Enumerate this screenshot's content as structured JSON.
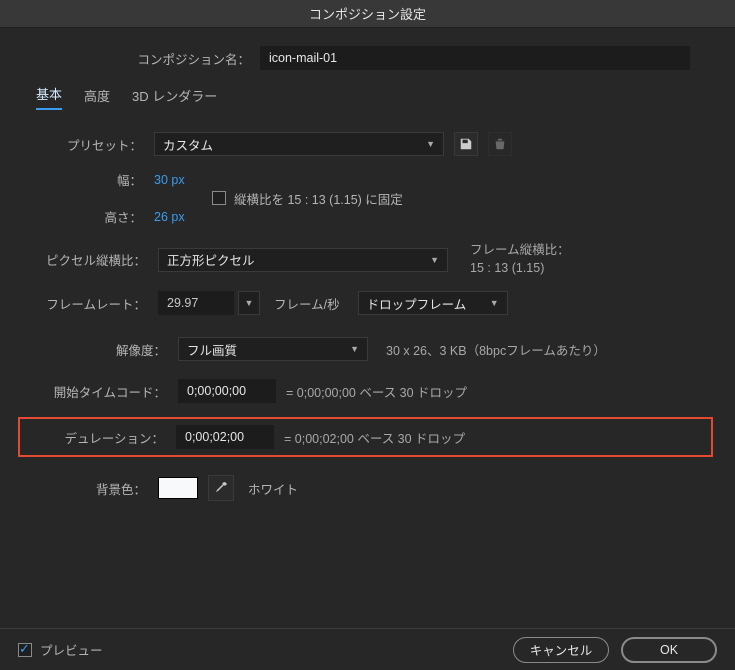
{
  "title": "コンポジション設定",
  "compName": {
    "label": "コンポジション名：",
    "value": "icon-mail-01"
  },
  "tabs": {
    "basic": "基本",
    "advanced": "高度",
    "renderer": "3D レンダラー"
  },
  "preset": {
    "label": "プリセット：",
    "value": "カスタム"
  },
  "width": {
    "label": "幅：",
    "value": "30 px"
  },
  "height": {
    "label": "高さ：",
    "value": "26 px"
  },
  "lockAspect": "縦横比を 15 : 13 (1.15) に固定",
  "par": {
    "label": "ピクセル縦横比：",
    "value": "正方形ピクセル",
    "rightTitle": "フレーム縦横比：",
    "rightValue": "15 : 13 (1.15)"
  },
  "frameRate": {
    "label": "フレームレート：",
    "value": "29.97",
    "unit": "フレーム/秒",
    "drop": "ドロップフレーム"
  },
  "resolution": {
    "label": "解像度：",
    "value": "フル画質",
    "info": "30 x 26、3 KB（8bpcフレームあたり）"
  },
  "startTC": {
    "label": "開始タイムコード：",
    "value": "0;00;00;00",
    "info": "= 0;00;00;00 ベース 30 ドロップ"
  },
  "duration": {
    "label": "デュレーション：",
    "value": "0;00;02;00",
    "info": "= 0;00;02;00 ベース 30 ドロップ"
  },
  "bg": {
    "label": "背景色：",
    "name": "ホワイト"
  },
  "footer": {
    "preview": "プレビュー",
    "cancel": "キャンセル",
    "ok": "OK"
  }
}
